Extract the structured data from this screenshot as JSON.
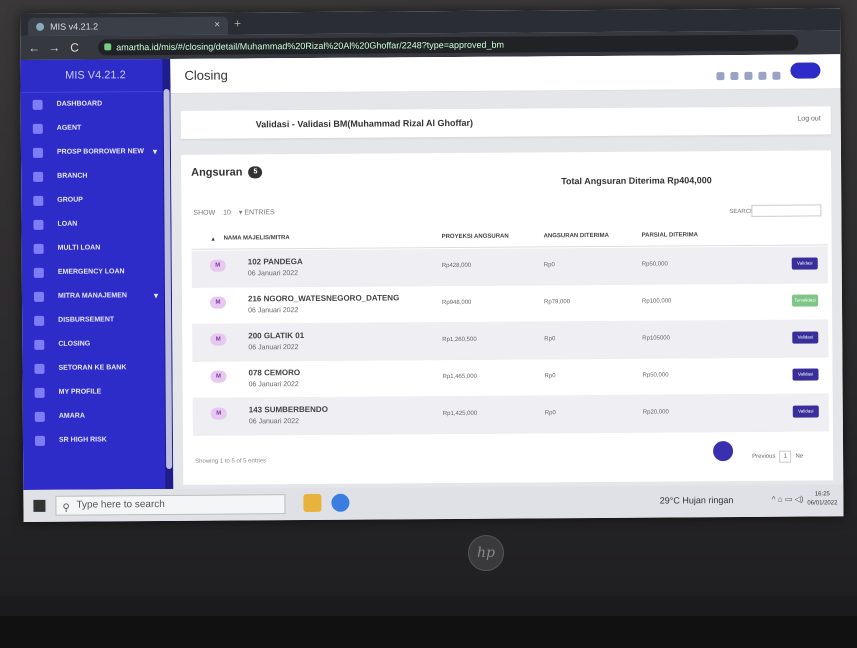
{
  "browser": {
    "tab_title": "MIS v4.21.2",
    "tab_close": "×",
    "new_tab": "+",
    "back": "←",
    "forward": "→",
    "reload": "C",
    "url": "amartha.id/mis/#/closing/detail/Muhammad%20Rizal%20Al%20Ghoffar/2248?type=approved_bm"
  },
  "sidebar": {
    "brand": "MIS V4.21.2",
    "items": [
      {
        "label": "Dashboard"
      },
      {
        "label": "Agent"
      },
      {
        "label": "Prosp Borrower New",
        "caret": "▾"
      },
      {
        "label": "Branch"
      },
      {
        "label": "Group"
      },
      {
        "label": "Loan"
      },
      {
        "label": "Multi Loan"
      },
      {
        "label": "Emergency Loan"
      },
      {
        "label": "Mitra Manajemen",
        "caret": "▾"
      },
      {
        "label": "Disbursement"
      },
      {
        "label": "Closing"
      },
      {
        "label": "Setoran Ke Bank"
      },
      {
        "label": "My Profile"
      },
      {
        "label": "Amara"
      },
      {
        "label": "SR High Risk"
      }
    ]
  },
  "header": {
    "title": "Closing",
    "logout": "Log out"
  },
  "validasi": {
    "text": "Validasi - Validasi BM(Muhammad Rizal Al Ghoffar)"
  },
  "angsuran": {
    "title": "Angsuran",
    "count": "5",
    "total": "Total Angsuran Diterima Rp404,000",
    "show_label": "SHOW",
    "show_value": "10",
    "entries_label": "ENTRIES",
    "search_label": "SEARCH:",
    "columns": [
      "NAMA MAJELIS/MITRA",
      "PROYEKSI ANGSURAN",
      "ANGSURAN DITERIMA",
      "PARSIAL DITERIMA"
    ],
    "rows": [
      {
        "badge": "M",
        "name": "102 PANDEGA",
        "date": "06 Januari 2022",
        "proyeksi": "Rp428,000",
        "diterima": "Rp0",
        "parsial": "Rp50,000",
        "action": "Validasi",
        "action_style": "primary"
      },
      {
        "badge": "M",
        "name": "216 NGORO_WATESNEGORO_DATENG",
        "date": "06 Januari 2022",
        "proyeksi": "Rp948,000",
        "diterima": "Rp79,000",
        "parsial": "Rp100,000",
        "action": "Tervalidasi",
        "action_style": "success"
      },
      {
        "badge": "M",
        "name": "200 GLATIK 01",
        "date": "06 Januari 2022",
        "proyeksi": "Rp1,260,500",
        "diterima": "Rp0",
        "parsial": "Rp105000",
        "action": "Validasi",
        "action_style": "primary"
      },
      {
        "badge": "M",
        "name": "078 CEMORO",
        "date": "06 Januari 2022",
        "proyeksi": "Rp1,465,000",
        "diterima": "Rp0",
        "parsial": "Rp50,000",
        "action": "Validasi",
        "action_style": "primary"
      },
      {
        "badge": "M",
        "name": "143 SUMBERBENDO",
        "date": "06 Januari 2022",
        "proyeksi": "Rp1,425,000",
        "diterima": "Rp0",
        "parsial": "Rp20,000",
        "action": "Validasi",
        "action_style": "primary"
      }
    ],
    "footer": "Showing 1 to 5 of 5 entries",
    "pager_prev": "Previous",
    "pager_page": "1",
    "pager_next": "Ne"
  },
  "taskbar": {
    "search_placeholder": "Type here to search",
    "weather": "29°C  Hujan ringan",
    "sys": "^ ⌂ ▭ ◁)",
    "time": "16:25",
    "date": "06/01/2022"
  },
  "laptop": {
    "logo": "hp"
  },
  "colors": {
    "sidebar": "#2d2cc9",
    "validate_button": "#3a2f9a",
    "validated_button": "#7fc686"
  }
}
